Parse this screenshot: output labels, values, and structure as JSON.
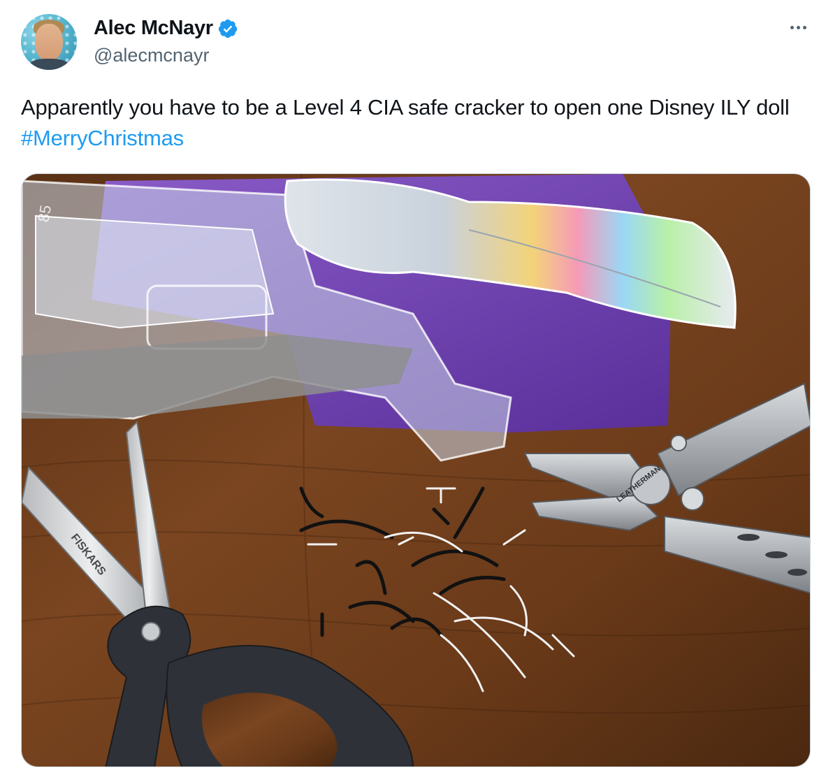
{
  "author": {
    "display_name": "Alec McNayr",
    "handle": "@alecmcnayr",
    "verified": true,
    "avatar_icon": "avatar-photo"
  },
  "tweet": {
    "text_main": "Apparently you have to be a Level 4 CIA safe cracker to open one Disney ILY doll ",
    "hashtag": "#MerryChristmas"
  },
  "media": {
    "image_text": {
      "scissors_brand": "FISKARS",
      "multitool_brand": "LEATHERMAN",
      "box_code": "85"
    }
  },
  "colors": {
    "hashtag": "#1d9bf0",
    "verified_badge": "#1d9bf0",
    "secondary_text": "#536471",
    "border": "#cfd9de"
  },
  "icons": {
    "more": "more-horizontal-icon",
    "verified": "verified-badge-icon"
  }
}
